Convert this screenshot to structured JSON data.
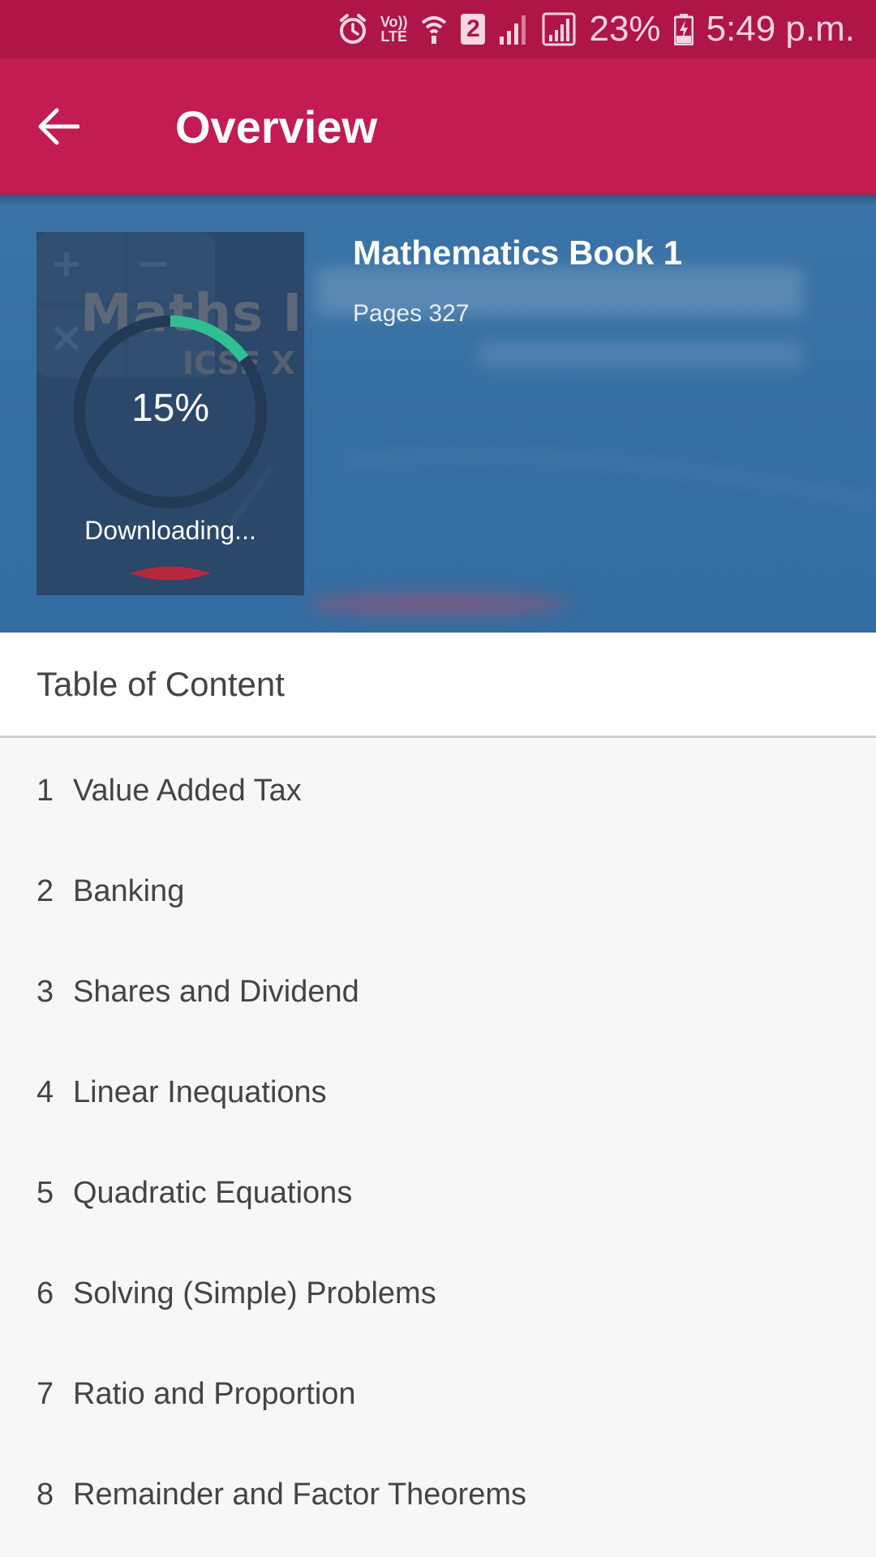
{
  "status_bar": {
    "lte_label_top": "Vo))",
    "lte_label_bottom": "LTE",
    "sim_slot": "2",
    "battery_percent": "23%",
    "time": "5:49 p.m.",
    "icons": [
      "alarm-icon",
      "volte-icon",
      "wifi-icon",
      "sim-icon",
      "signal-icon",
      "signal-icon",
      "battery-charging-icon"
    ]
  },
  "app_bar": {
    "title": "Overview",
    "back_icon": "arrow-left-icon"
  },
  "book": {
    "title": "Mathematics Book 1",
    "pages": "Pages 327",
    "cover_title": "Maths I",
    "cover_subtitle": "ICSE X",
    "download_progress_percent": 15,
    "download_progress_label": "15%",
    "download_status": "Downloading..."
  },
  "toc": {
    "header": "Table of Content",
    "items": [
      {
        "num": "1",
        "label": "Value Added Tax"
      },
      {
        "num": "2",
        "label": "Banking"
      },
      {
        "num": "3",
        "label": "Shares and Dividend"
      },
      {
        "num": "4",
        "label": "Linear Inequations"
      },
      {
        "num": "5",
        "label": "Quadratic Equations"
      },
      {
        "num": "6",
        "label": "Solving (Simple) Problems"
      },
      {
        "num": "7",
        "label": "Ratio and Proportion"
      },
      {
        "num": "8",
        "label": "Remainder and Factor Theorems"
      }
    ]
  },
  "colors": {
    "status_bar": "#af1547",
    "app_bar": "#c21c52",
    "hero_background": "#356ea2",
    "progress_accent": "#2fbf91",
    "list_background": "#f7f7f7"
  }
}
